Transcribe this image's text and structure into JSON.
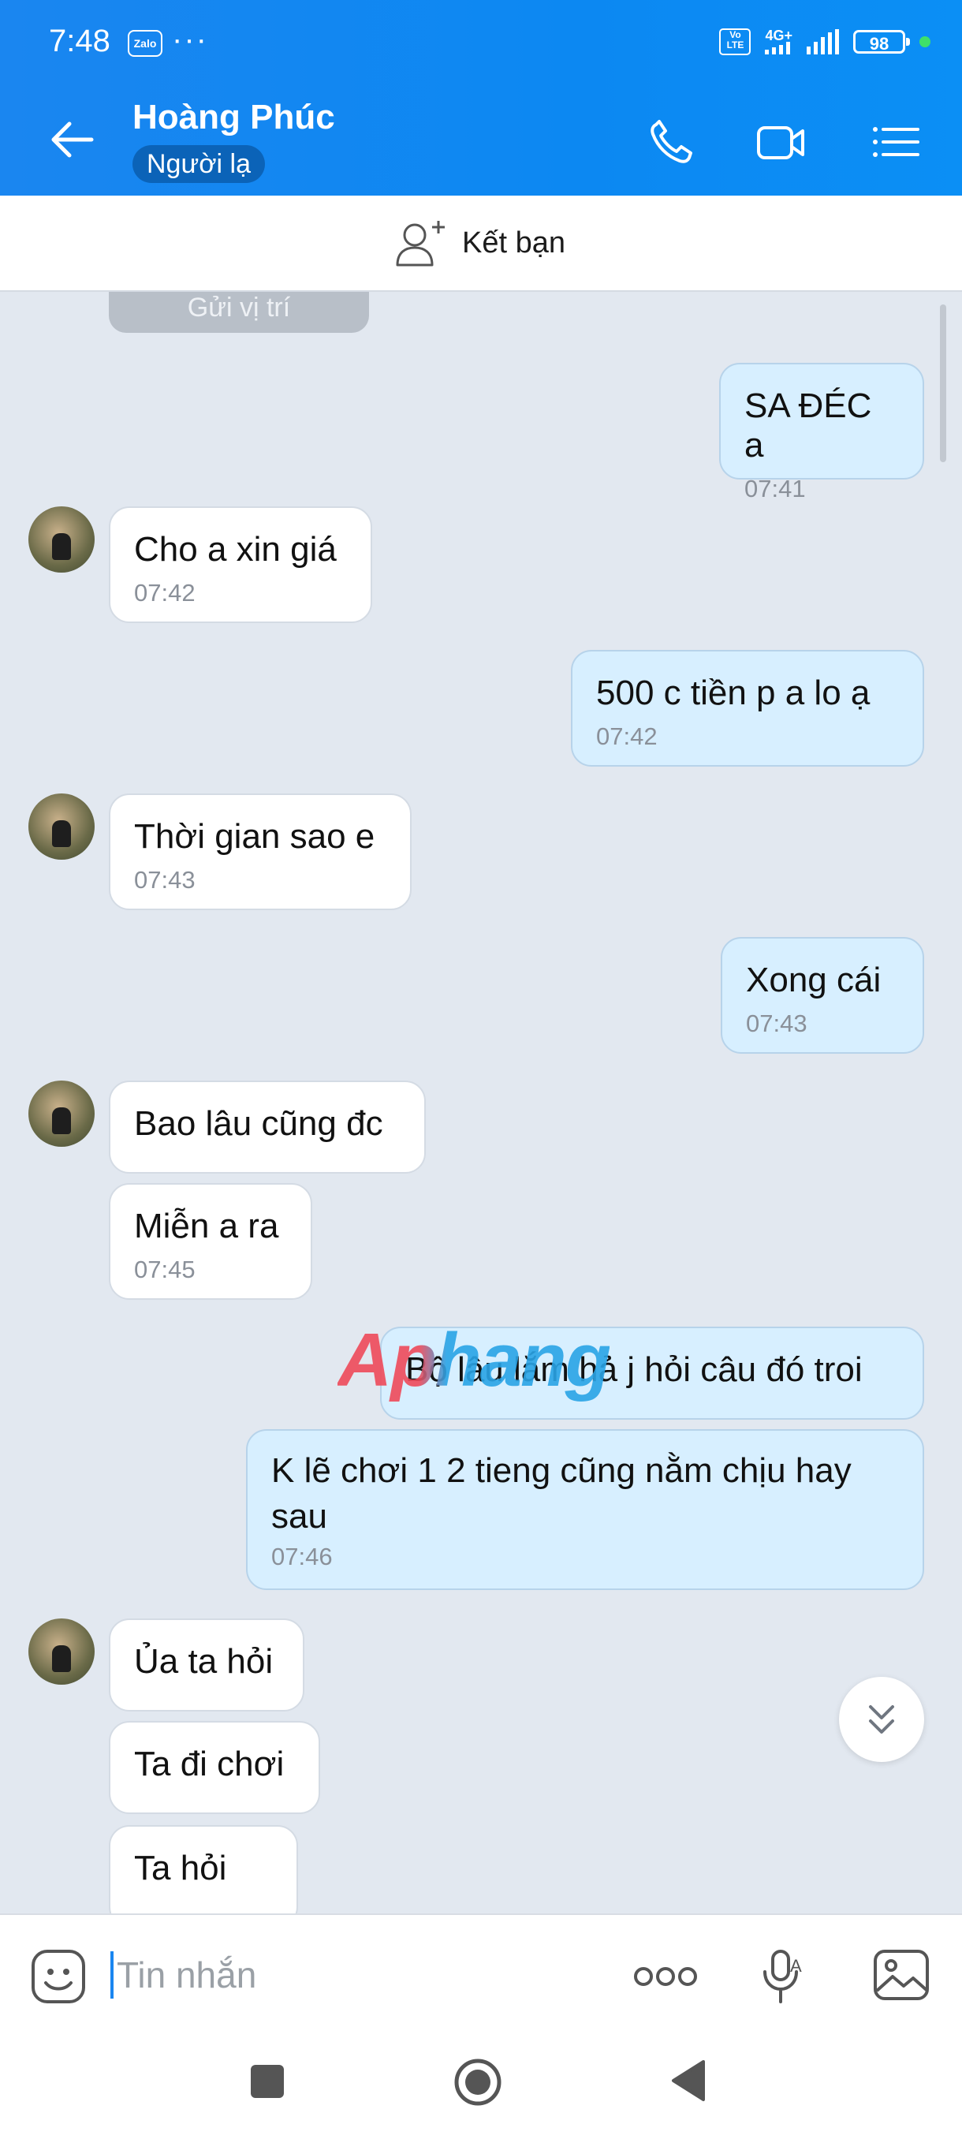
{
  "status_bar": {
    "time": "7:48",
    "app_icon": "zalo-icon",
    "more_dots": "···",
    "network": "4G+",
    "volte": "Vo LTE",
    "battery": "98"
  },
  "header": {
    "contact_name": "Hoàng Phúc",
    "stranger_label": "Người lạ",
    "icons": [
      "back-arrow-icon",
      "phone-icon",
      "video-call-icon",
      "menu-list-icon"
    ]
  },
  "friend_bar": {
    "label": "Kết bạn",
    "icon": "add-user-icon"
  },
  "chat": {
    "partial_top": "Gửi vị trí",
    "messages": [
      {
        "dir": "out",
        "text": "SA ĐÉC a",
        "time": "07:41"
      },
      {
        "dir": "in",
        "text": "Cho a xin giá",
        "time": "07:42"
      },
      {
        "dir": "out",
        "text": "500 c tiền p a lo ạ",
        "time": "07:42"
      },
      {
        "dir": "in",
        "text": "Thời gian sao e",
        "time": "07:43"
      },
      {
        "dir": "out",
        "text": "Xong cái",
        "time": "07:43"
      },
      {
        "dir": "in",
        "text": "Bao lâu cũng đc",
        "time": ""
      },
      {
        "dir": "in",
        "text": "Miễn a ra",
        "time": "07:45"
      },
      {
        "dir": "out",
        "text": "Bộ lâu lắm hả j hỏi câu đó troi",
        "time": ""
      },
      {
        "dir": "out",
        "text": "K lẽ chơi 1 2 tieng cũng nằm chịu hay sau",
        "time": "07:46"
      },
      {
        "dir": "in",
        "text": "Ủa ta hỏi",
        "time": ""
      },
      {
        "dir": "in",
        "text": "Ta đi chơi",
        "time": ""
      },
      {
        "dir": "in",
        "text": "Ta hỏi",
        "time": ""
      }
    ],
    "watermark": "Aphang"
  },
  "input_bar": {
    "placeholder": "Tin nhắn",
    "icons": [
      "emoji-icon",
      "more-options-icon",
      "voice-to-text-icon",
      "image-icon"
    ]
  },
  "nav_bar": {
    "icons": [
      "recent-apps-icon",
      "home-icon",
      "back-icon"
    ]
  },
  "colors": {
    "header_blue": "#1a86f0",
    "chat_bg": "#e2e8f0",
    "out_bubble": "#d7efff",
    "in_bubble": "#ffffff"
  }
}
